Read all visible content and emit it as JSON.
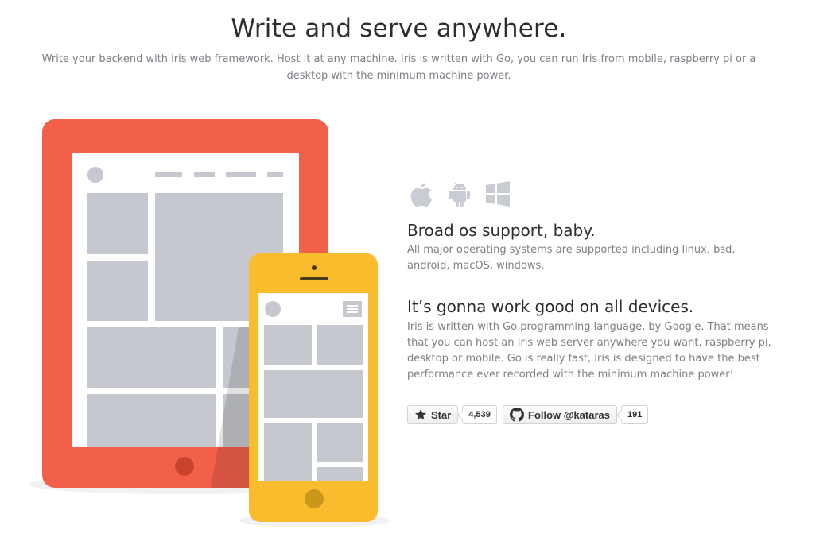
{
  "hero": {
    "title": "Write and serve anywhere.",
    "subtitle": "Write your backend with iris web framework. Host it at any machine. Iris is written with Go, you can run Iris from mobile, raspberry pi or a desktop with the minimum machine power."
  },
  "os_icons": [
    "apple-icon",
    "android-icon",
    "windows-icon"
  ],
  "features": {
    "os": {
      "title": "Broad os support, baby.",
      "text": "All major operating systems are supported including linux, bsd, android, macOS, windows."
    },
    "devices": {
      "title": "It’s gonna work good on all devices.",
      "text": "Iris is written with Go programming language, by Google. That means that you can host an Iris web server anywhere you want, raspberry pi, desktop or mobile. Go is really fast, Iris is designed to have the best performance ever recorded with the minimum machine power!"
    }
  },
  "github": {
    "star_label": "Star",
    "star_count": "4,539",
    "follow_label": "Follow @kataras",
    "follow_count": "191"
  },
  "colors": {
    "tablet": "#f2604a",
    "phone": "#f9bc2c",
    "placeholder": "#c5c8cf",
    "text": "#7d7f86",
    "heading": "#2d2d2d"
  }
}
